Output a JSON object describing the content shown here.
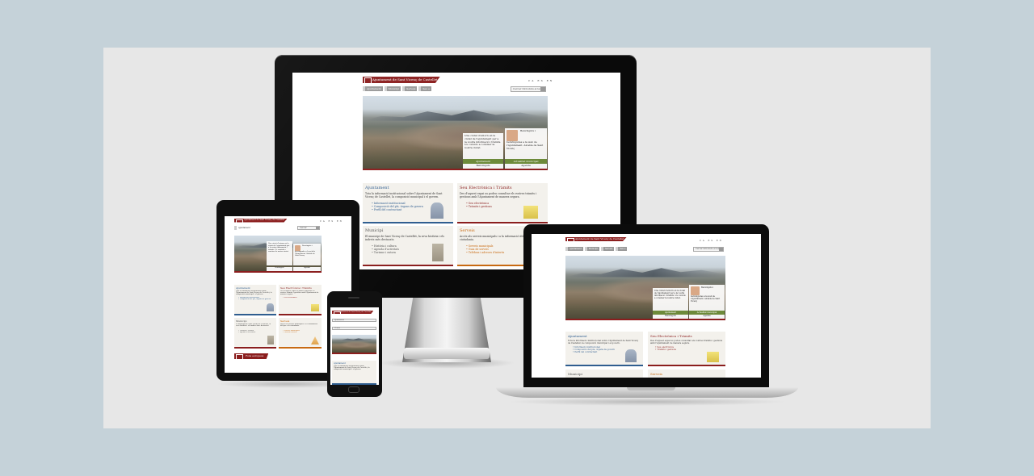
{
  "site": {
    "logo_text": "Ajuntament de Sant Vicenç de Castellet",
    "languages": "CA  ES  EN",
    "nav": [
      "Ajuntament",
      "Municipi",
      "Serveis",
      "Seu e"
    ],
    "search_label": "Cercar",
    "search_placeholder": "Introduïu el text",
    "hero": {
      "card_text": "Una ciutat d'entorn en la ciutat de l'ajuntament per a la vostra informació i tràmits. Us convido a conèixer la nostra ciutat.",
      "mayor_text": "Benvinguts i benvingudes a la web de l'Ajuntament. Alcalde de Sant Vicenç",
      "left_band": "Ajuntament",
      "right_band": "Actualitat municipal",
      "left_foot": "Benvinguts",
      "right_foot": "Agenda"
    },
    "tiles": [
      {
        "title": "Ajuntament",
        "text": "Tota la informació institucional sobre l'Ajuntament de Sant Vicenç de Castellet, la composició municipal i el govern.",
        "items": [
          "Informació institucional",
          "Composició del ple, òrgans de govern",
          "Perfil del contractant"
        ]
      },
      {
        "title": "Seu Electrònica i Tràmits",
        "text": "Des d'aquest espai us podeu consultar els vostres tràmits i gestions amb l'Ajuntament de manera segura.",
        "items": [
          "Seu electrònica",
          "Tràmits i gestions"
        ]
      },
      {
        "title": "Municipi",
        "text": "El municipi de Sant Vicenç de Castellet, la seva història i els indrets més destacats.",
        "items": [
          "Història i cultura",
          "Agenda d'activitats",
          "Turisme i entorn"
        ]
      },
      {
        "title": "Serveis",
        "text": "Accés als serveis municipals i a la informació útil per a la ciutadania.",
        "items": [
          "Serveis municipals",
          "Guia de serveis",
          "Telèfons i adreces d'interès"
        ]
      }
    ],
    "footer_brand": "Fons europeus"
  }
}
